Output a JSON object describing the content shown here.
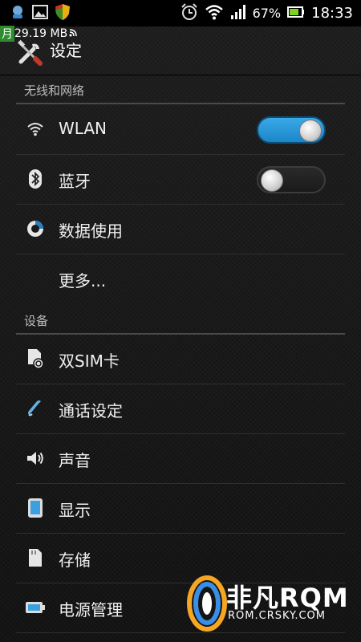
{
  "status_bar": {
    "battery_percent": "67%",
    "time": "18:33",
    "icons": [
      "cloud-app-icon",
      "picture-icon",
      "shield-icon",
      "alarm-icon",
      "wifi-icon",
      "signal-icon",
      "battery-icon"
    ]
  },
  "traffic_overlay": {
    "month_tag": "月",
    "amount": "29.19 MB"
  },
  "app_bar": {
    "title": "设定",
    "icon": "tools-icon"
  },
  "sections": [
    {
      "header": "无线和网络"
    },
    {
      "header": "设备"
    }
  ],
  "wireless_items": [
    {
      "label": "WLAN",
      "icon": "wifi-icon",
      "toggle": true,
      "toggle_on": true
    },
    {
      "label": "蓝牙",
      "icon": "bluetooth-icon",
      "toggle": true,
      "toggle_on": false
    },
    {
      "label": "数据使用",
      "icon": "data-usage-icon",
      "toggle": false
    },
    {
      "label": "更多...",
      "icon": "",
      "toggle": false
    }
  ],
  "device_items": [
    {
      "label": "双SIM卡",
      "icon": "dual-sim-icon"
    },
    {
      "label": "通话设定",
      "icon": "phone-handset-icon"
    },
    {
      "label": "声音",
      "icon": "speaker-icon"
    },
    {
      "label": "显示",
      "icon": "display-icon"
    },
    {
      "label": "存储",
      "icon": "sd-card-icon"
    },
    {
      "label": "电源管理",
      "icon": "battery-icon"
    }
  ],
  "watermark": {
    "brand": "非凡RQM",
    "url": "ROM.CRSKY.COM"
  },
  "colors": {
    "accent": "#1e90d6",
    "background": "#141414",
    "traffic_tag": "#2e8b2e"
  }
}
